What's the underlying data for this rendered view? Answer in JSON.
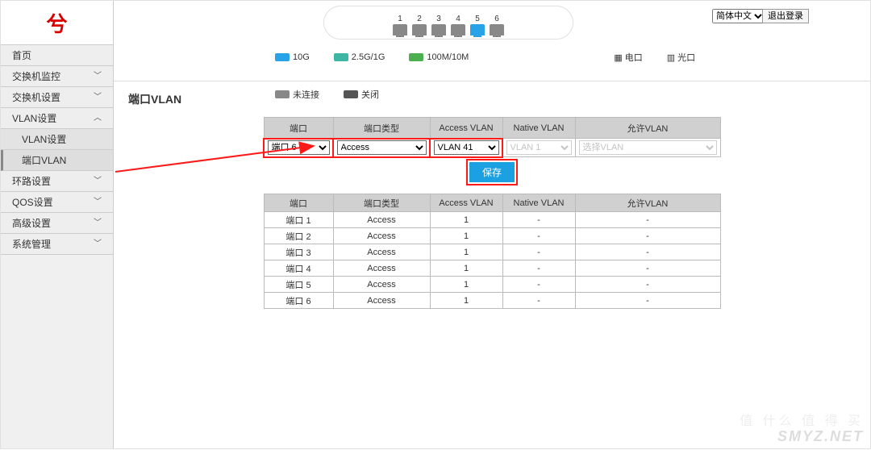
{
  "lang_options": [
    "简体中文"
  ],
  "logout": "退出登录",
  "ports": [
    {
      "n": "1",
      "active": false
    },
    {
      "n": "2",
      "active": false
    },
    {
      "n": "3",
      "active": false
    },
    {
      "n": "4",
      "active": false
    },
    {
      "n": "5",
      "active": true
    },
    {
      "n": "6",
      "active": false
    }
  ],
  "legend": {
    "l10g": "10G",
    "l25g": "2.5G/1G",
    "l100m": "100M/10M",
    "elec": "电口",
    "opt": "光口",
    "noconn": "未连接",
    "off": "关闭"
  },
  "nav": {
    "home": "首页",
    "monitor": "交换机监控",
    "switch_set": "交换机设置",
    "vlan_set": "VLAN设置",
    "sub_vlan_set": "VLAN设置",
    "sub_port_vlan": "端口VLAN",
    "loop": "环路设置",
    "qos": "QOS设置",
    "adv": "高级设置",
    "sys": "系统管理"
  },
  "page_title": "端口VLAN",
  "headers": {
    "port": "端口",
    "type": "端口类型",
    "access": "Access VLAN",
    "native": "Native VLAN",
    "allow": "允许VLAN"
  },
  "config": {
    "port_sel": "端口 6",
    "type_sel": "Access",
    "access_sel": "VLAN 41",
    "native_placeholder": "VLAN 1",
    "allow_placeholder": "选择VLAN",
    "save": "保存"
  },
  "rows": [
    {
      "port": "端口 1",
      "type": "Access",
      "access": "1",
      "native": "-",
      "allow": "-"
    },
    {
      "port": "端口 2",
      "type": "Access",
      "access": "1",
      "native": "-",
      "allow": "-"
    },
    {
      "port": "端口 3",
      "type": "Access",
      "access": "1",
      "native": "-",
      "allow": "-"
    },
    {
      "port": "端口 4",
      "type": "Access",
      "access": "1",
      "native": "-",
      "allow": "-"
    },
    {
      "port": "端口 5",
      "type": "Access",
      "access": "1",
      "native": "-",
      "allow": "-"
    },
    {
      "port": "端口 6",
      "type": "Access",
      "access": "1",
      "native": "-",
      "allow": "-"
    }
  ],
  "watermark_cn": "值 什么 值 得 买",
  "watermark_en": "SMYZ.NET"
}
